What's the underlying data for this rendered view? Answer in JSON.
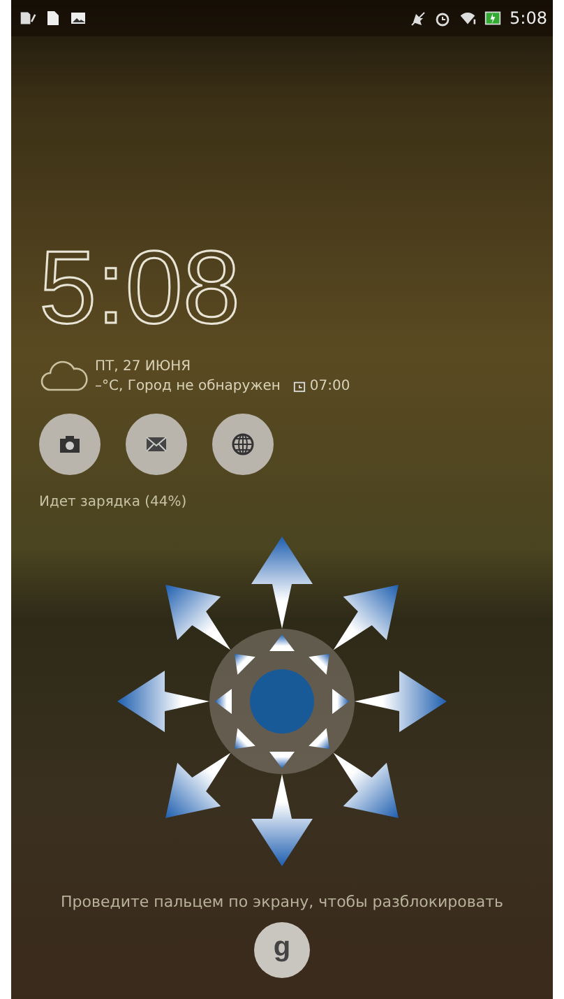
{
  "status_bar": {
    "time": "5:08"
  },
  "clock": {
    "time": "5:08"
  },
  "weather": {
    "date": "ПТ, 27 ИЮНЯ",
    "location": "–°С, Город не обнаружен",
    "alarm": "07:00"
  },
  "shortcuts": [
    {
      "kind": "camera"
    },
    {
      "kind": "mail"
    },
    {
      "kind": "browser"
    }
  ],
  "charging": "Идет зарядка (44%)",
  "unlock_hint": "Проведите пальцем по экрану, чтобы разблокировать",
  "google_button": {
    "label": "g"
  }
}
